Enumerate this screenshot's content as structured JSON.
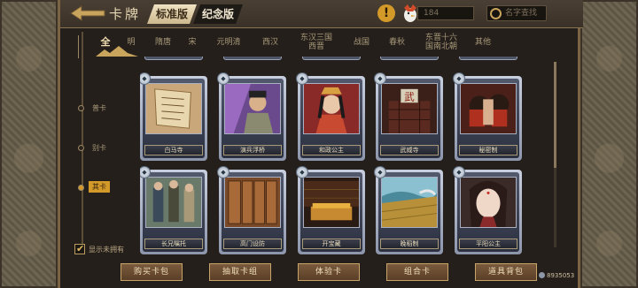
{
  "header": {
    "title": "卡牌",
    "version_standard": "标准版",
    "version_commemorative": "纪念版",
    "currency_value": "184",
    "search_placeholder": "名字查找",
    "warning_symbol": "!"
  },
  "tabs": [
    "全",
    "明",
    "隋唐",
    "宋",
    "元明清",
    "西汉",
    "东汉三国\n西晋",
    "战国",
    "春秋",
    "东晋十六\n国南北朝",
    "其他"
  ],
  "rail": [
    {
      "label": "普卡"
    },
    {
      "label": "别卡"
    },
    {
      "label": "其卡"
    }
  ],
  "cards": [
    {
      "name": "白马寺"
    },
    {
      "name": "演兵浮桥"
    },
    {
      "name": "和政公主"
    },
    {
      "name": "武威寺"
    },
    {
      "name": "秘密制"
    },
    {
      "name": "长兄嘱托"
    },
    {
      "name": "高门设防"
    },
    {
      "name": "开宝藏"
    },
    {
      "name": "晚稻制"
    },
    {
      "name": "平阳公主"
    }
  ],
  "checkbox_label": "显示未拥有",
  "buttons": [
    "购买卡包",
    "抽取卡组",
    "体验卡",
    "组合卡",
    "道具背包"
  ],
  "coin_text": "8935053",
  "colors": {
    "accent": "#d39a2a",
    "card_border": "#c8cfdf",
    "frame": "#7a6443"
  }
}
